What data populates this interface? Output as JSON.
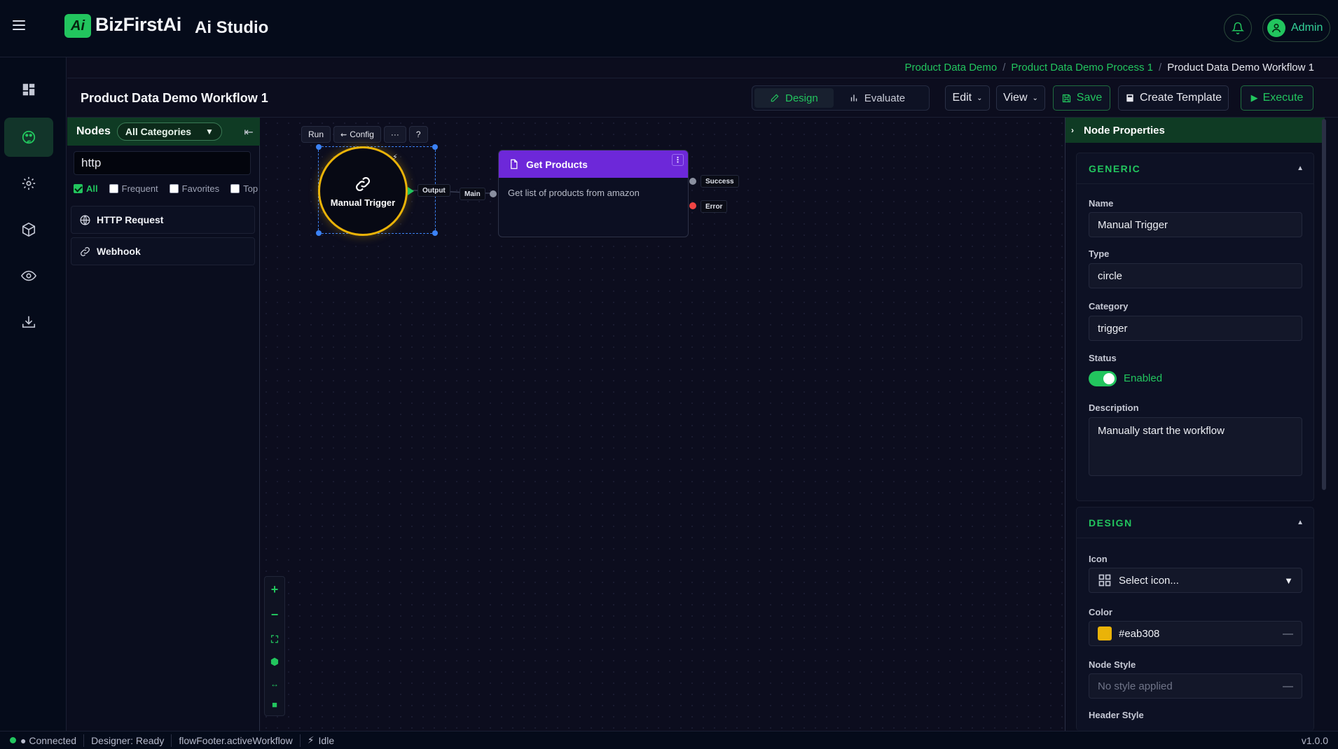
{
  "header": {
    "brand": "BizFirstAi",
    "logo_glyph": "Ai",
    "studio": "Ai Studio",
    "user": "Admin"
  },
  "breadcrumb": {
    "items": [
      "Product Data Demo",
      "Product Data Demo Process 1"
    ],
    "current": "Product Data Demo Workflow 1",
    "separator": "/"
  },
  "toolbar": {
    "title": "Product Data Demo Workflow 1",
    "tabs": [
      {
        "label": "Design",
        "active": true
      },
      {
        "label": "Evaluate",
        "active": false
      }
    ],
    "edit_label": "Edit",
    "view_label": "View",
    "save_label": "Save",
    "create_template_label": "Create Template",
    "execute_label": "Execute"
  },
  "nodes_panel": {
    "title": "Nodes",
    "category": "All Categories",
    "search_value": "http",
    "filters": [
      {
        "label": "All",
        "checked": true
      },
      {
        "label": "Frequent",
        "checked": false
      },
      {
        "label": "Favorites",
        "checked": false
      },
      {
        "label": "Top",
        "checked": false
      }
    ],
    "items": [
      {
        "label": "HTTP Request",
        "icon": "globe-icon"
      },
      {
        "label": "Webhook",
        "icon": "link-icon"
      }
    ]
  },
  "canvas": {
    "context_menu": {
      "run": "Run",
      "config": "Config",
      "more": "···",
      "help": "?"
    },
    "trigger_node": {
      "label": "Manual Trigger",
      "output_label": "Output",
      "color": "#eab308"
    },
    "card_node": {
      "title": "Get Products",
      "description": "Get list of products from amazon",
      "input_label": "Main",
      "success_label": "Success",
      "error_label": "Error",
      "header_color": "#6d28d9",
      "menu_glyph": "⋮"
    },
    "zoom_controls": [
      "zoom-in",
      "zoom-out",
      "fit-view",
      "minimap",
      "auto-layout",
      "lock"
    ]
  },
  "properties": {
    "title": "Node Properties",
    "generic": {
      "heading": "GENERIC",
      "name_label": "Name",
      "name_value": "Manual Trigger",
      "type_label": "Type",
      "type_value": "circle",
      "category_label": "Category",
      "category_value": "trigger",
      "status_label": "Status",
      "status_value": "Enabled",
      "description_label": "Description",
      "description_value": "Manually start the workflow"
    },
    "design": {
      "heading": "DESIGN",
      "icon_label": "Icon",
      "icon_placeholder": "Select icon...",
      "color_label": "Color",
      "color_value": "#eab308",
      "node_style_label": "Node Style",
      "node_style_value": "No style applied",
      "header_style_label": "Header Style"
    }
  },
  "footer": {
    "connection": "● Connected",
    "designer": "Designer: Ready",
    "workflow": "flowFooter.activeWorkflow",
    "state": "Idle",
    "version": "v1.0.0"
  },
  "colors": {
    "accent": "#22c55e",
    "node_header": "#6d28d9",
    "trigger_ring": "#eab308",
    "error": "#ef4444"
  }
}
